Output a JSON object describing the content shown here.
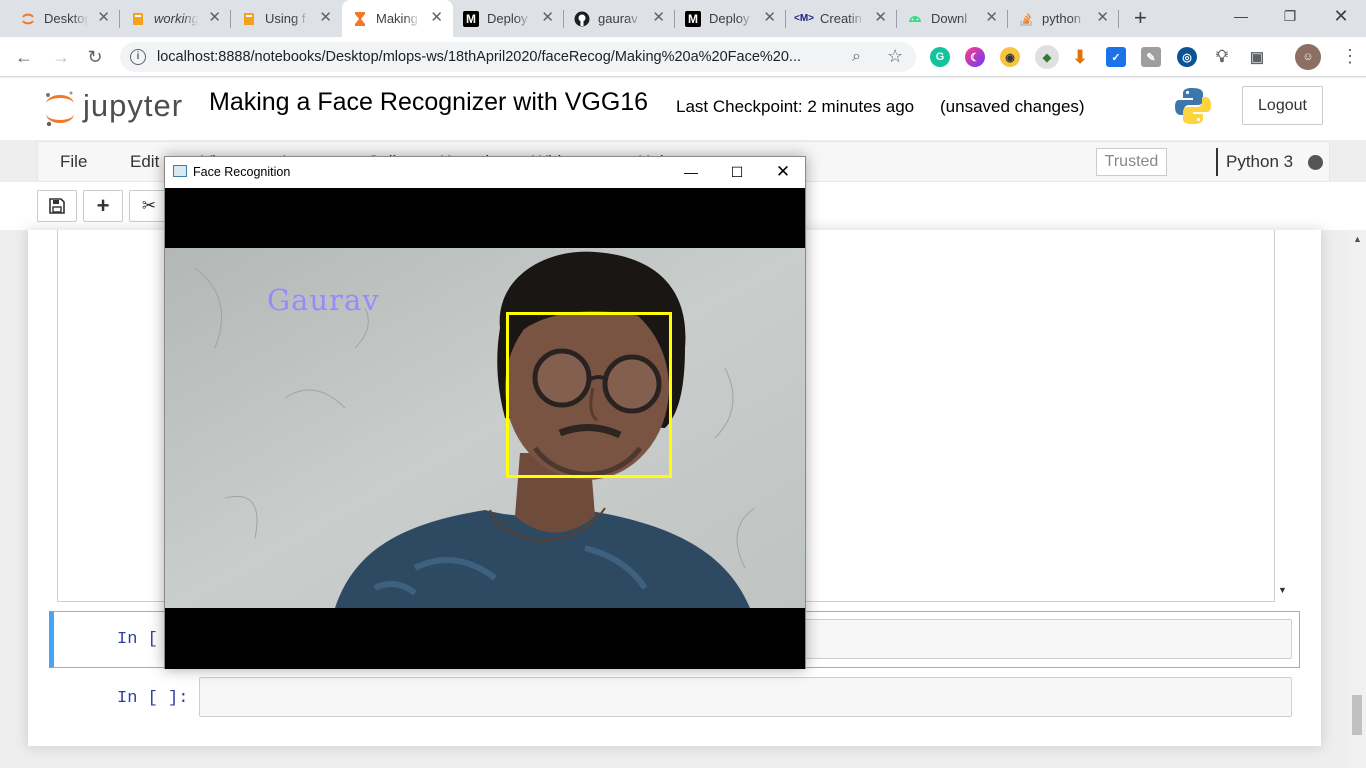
{
  "browser": {
    "tabs": [
      {
        "title": "Desktop",
        "icon": "jupyter-icon",
        "active": false
      },
      {
        "title": "working",
        "icon": "book-icon",
        "active": false
      },
      {
        "title": "Using f",
        "icon": "book-icon",
        "active": false
      },
      {
        "title": "Making",
        "icon": "hourglass-icon",
        "active": true
      },
      {
        "title": "Deploy",
        "icon": "medium-icon",
        "active": false
      },
      {
        "title": "gaurav",
        "icon": "github-icon",
        "active": false
      },
      {
        "title": "Deploy",
        "icon": "medium-icon",
        "active": false
      },
      {
        "title": "Creatin",
        "icon": "site-icon",
        "active": false
      },
      {
        "title": "Downl",
        "icon": "android-icon",
        "active": false
      },
      {
        "title": "python",
        "icon": "stackoverflow-icon",
        "active": false
      }
    ],
    "url": "localhost:8888/notebooks/Desktop/mlops-ws/18thApril2020/faceRecog/Making%20a%20Face%20..."
  },
  "jupyter": {
    "logo_text": "jupyter",
    "notebook_title": "Making a Face Recognizer with VGG16",
    "checkpoint": "Last Checkpoint: 2 minutes ago",
    "unsaved": "(unsaved changes)",
    "logout_label": "Logout",
    "menus": [
      "File",
      "Edit",
      "View",
      "Insert",
      "Cell",
      "Kernel",
      "Widgets",
      "Help"
    ],
    "trusted_label": "Trusted",
    "kernel_name": "Python 3",
    "cells": [
      {
        "prompt": "In [ ]:"
      },
      {
        "prompt": "In [ ]:"
      }
    ]
  },
  "face_window": {
    "title": "Face Recognition",
    "recognized_name": "Gaurav",
    "box_color": "#ffff00",
    "name_color": "#9a88ff"
  },
  "colors": {
    "cell_selected_border": "#42a5f5",
    "prompt": "#303f9f"
  }
}
